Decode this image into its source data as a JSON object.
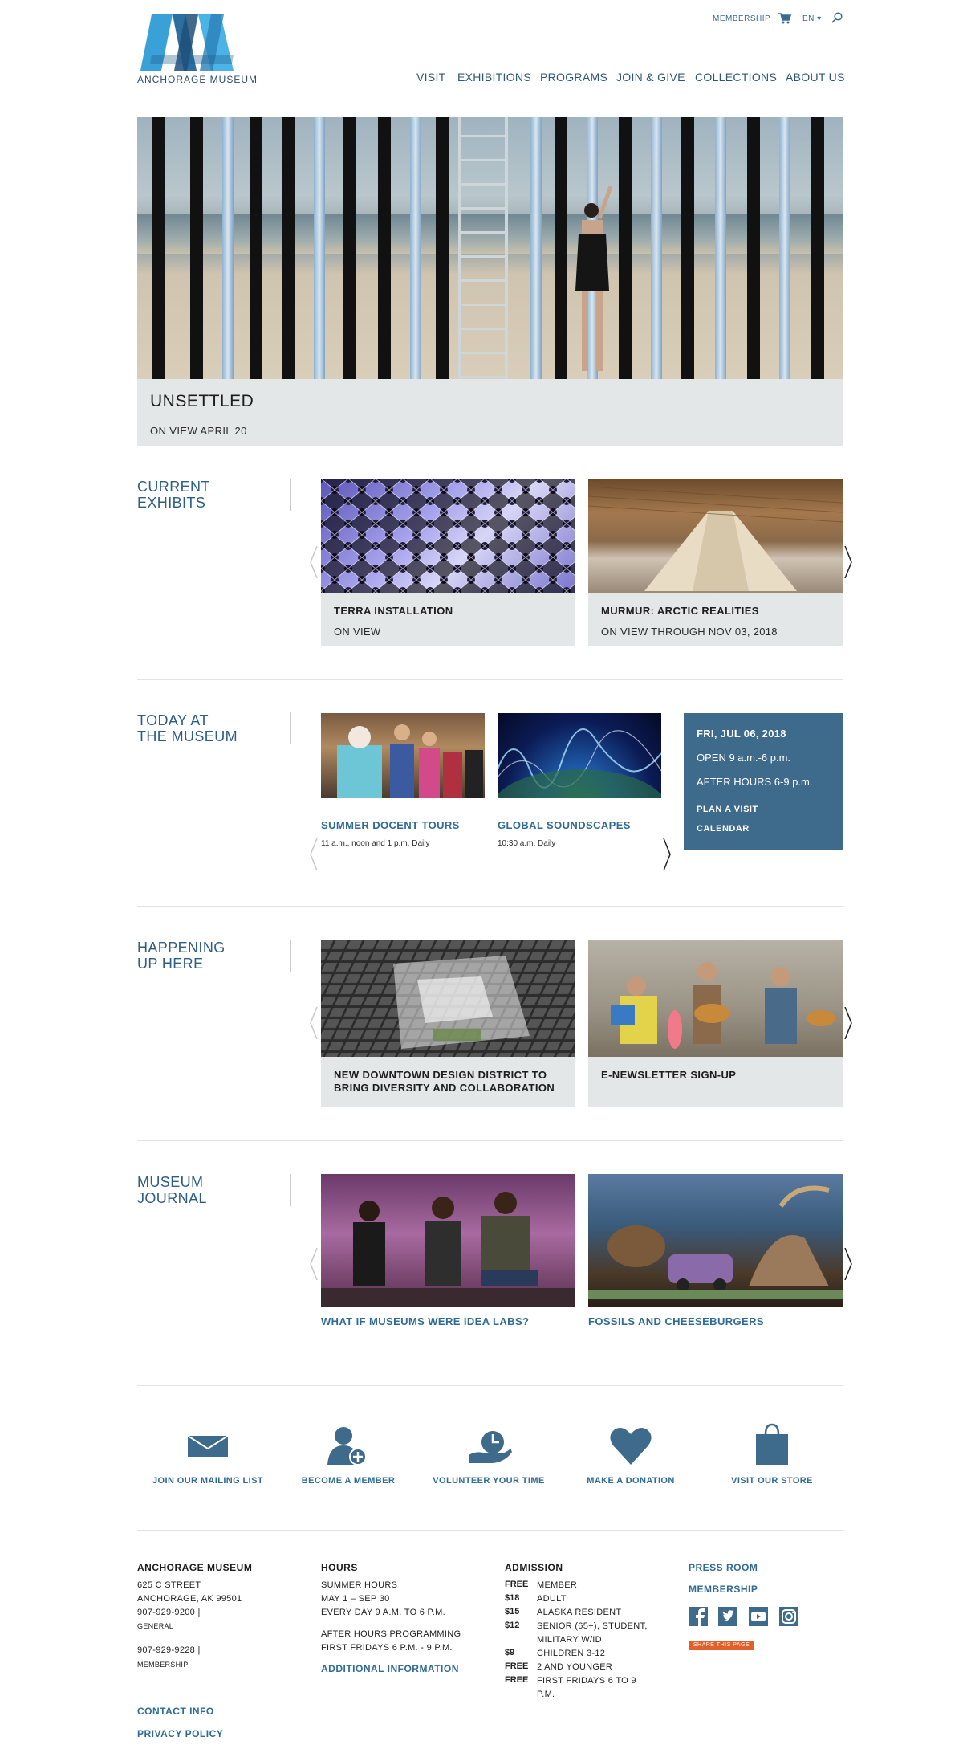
{
  "header": {
    "logo_text": "ANCHORAGE MUSEUM",
    "membership": "MEMBERSHIP",
    "language": "EN",
    "nav": [
      "VISIT",
      "EXHIBITIONS",
      "PROGRAMS",
      "JOIN & GIVE",
      "COLLECTIONS",
      "ABOUT US"
    ]
  },
  "hero": {
    "title": "UNSETTLED",
    "subtitle": "ON VIEW APRIL 20"
  },
  "current_exhibits": {
    "title_line1": "CURRENT",
    "title_line2": "EXHIBITS",
    "cards": [
      {
        "title": "TERRA INSTALLATION",
        "subtitle": "ON VIEW"
      },
      {
        "title": "MURMUR: ARCTIC REALITIES",
        "subtitle": "ON VIEW THROUGH NOV 03, 2018"
      }
    ]
  },
  "today": {
    "title_line1": "TODAY AT",
    "title_line2": "THE MUSEUM",
    "events": [
      {
        "title": "SUMMER DOCENT TOURS",
        "time": "11 a.m., noon and 1 p.m. Daily"
      },
      {
        "title": "GLOBAL SOUNDSCAPES",
        "time": "10:30 a.m. Daily"
      }
    ],
    "panel": {
      "date": "FRI, JUL 06, 2018",
      "open": "OPEN 9 a.m.-6 p.m.",
      "after_hours": "AFTER HOURS 6-9 p.m.",
      "plan": "PLAN A VISIT",
      "calendar": "CALENDAR"
    }
  },
  "happening": {
    "title_line1": "HAPPENING",
    "title_line2": "UP HERE",
    "cards": [
      {
        "title_line1": "NEW DOWNTOWN DESIGN DISTRICT TO",
        "title_line2": "BRING DIVERSITY AND COLLABORATION"
      },
      {
        "title_line1": "E-NEWSLETTER SIGN-UP"
      }
    ]
  },
  "journal": {
    "title_line1": "MUSEUM",
    "title_line2": "JOURNAL",
    "cards": [
      {
        "title": "WHAT IF MUSEUMS WERE IDEA LABS?"
      },
      {
        "title": "FOSSILS AND CHEESEBURGERS"
      }
    ]
  },
  "actions": [
    {
      "label": "JOIN OUR MAILING LIST",
      "icon": "envelope-icon"
    },
    {
      "label": "BECOME A MEMBER",
      "icon": "add-member-icon"
    },
    {
      "label": "VOLUNTEER YOUR TIME",
      "icon": "volunteer-clock-icon"
    },
    {
      "label": "MAKE A DONATION",
      "icon": "heart-icon"
    },
    {
      "label": "VISIT OUR STORE",
      "icon": "shopping-bag-icon"
    }
  ],
  "footer": {
    "museum": {
      "heading": "ANCHORAGE MUSEUM",
      "street": "625 C STREET",
      "city": "ANCHORAGE, AK 99501",
      "phone1": "907-929-9200 |",
      "phone1_label": "GENERAL",
      "phone2": "907-929-9228 |",
      "phone2_label": "MEMBERSHIP",
      "contact": "CONTACT INFO",
      "privacy": "PRIVACY POLICY"
    },
    "hours": {
      "heading": "HOURS",
      "line1": "SUMMER HOURS",
      "line2": "MAY 1 – SEP 30",
      "line3": "EVERY DAY 9 A.M. TO 6 P.M.",
      "line4": "AFTER HOURS PROGRAMMING",
      "line5": "FIRST FRIDAYS 6 P.M. - 9 P.M.",
      "more": "ADDITIONAL INFORMATION"
    },
    "admission": {
      "heading": "ADMISSION",
      "rows": [
        {
          "price": "FREE",
          "label": "MEMBER"
        },
        {
          "price": "$18",
          "label": "ADULT"
        },
        {
          "price": "$15",
          "label": "ALASKA RESIDENT"
        },
        {
          "price": "$12",
          "label": "SENIOR (65+), STUDENT,",
          "label2": "MILITARY W/ID"
        },
        {
          "price": "$9",
          "label": "CHILDREN 3-12"
        },
        {
          "price": "FREE",
          "label": "2 AND YOUNGER"
        },
        {
          "price": "FREE",
          "label": "FIRST FRIDAYS 6 TO 9",
          "label2": "P.M."
        }
      ]
    },
    "press": "PRESS ROOM",
    "membership": "MEMBERSHIP",
    "share": "SHARE THIS PAGE",
    "social": [
      "facebook-icon",
      "twitter-icon",
      "youtube-icon",
      "instagram-icon"
    ]
  }
}
